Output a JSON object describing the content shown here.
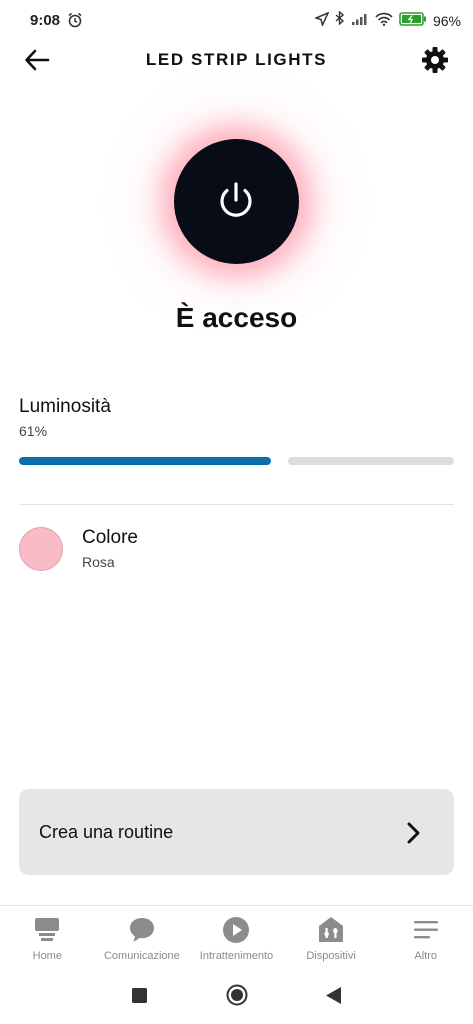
{
  "status_bar": {
    "time": "9:08",
    "battery": "96%"
  },
  "header": {
    "title": "LED STRIP LIGHTS"
  },
  "power": {
    "state_label": "È acceso"
  },
  "brightness": {
    "label": "Luminosità",
    "value_text": "61%",
    "level": 0.61,
    "fill_color": "#0a6fac"
  },
  "color": {
    "label": "Colore",
    "value": "Rosa",
    "swatch_color": "#f7bcc6"
  },
  "routine": {
    "label": "Crea una routine"
  },
  "bottom_nav": {
    "items": [
      {
        "label": "Home",
        "icon": "home-icon"
      },
      {
        "label": "Comunicazione",
        "icon": "chat-bubble-icon"
      },
      {
        "label": "Intrattenimento",
        "icon": "play-icon"
      },
      {
        "label": "Dispositivi",
        "icon": "devices-icon"
      },
      {
        "label": "Altro",
        "icon": "menu-icon"
      }
    ]
  }
}
